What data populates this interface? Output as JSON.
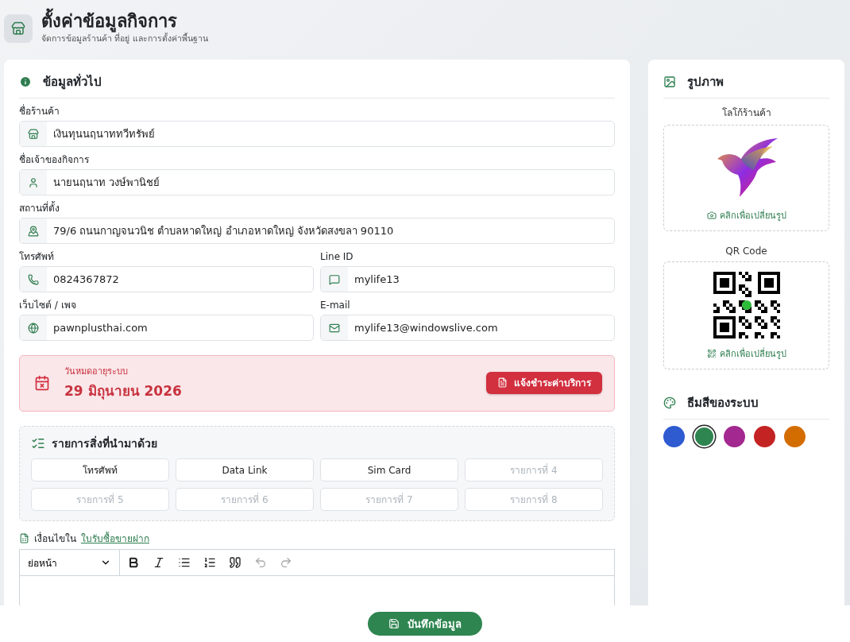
{
  "header": {
    "title": "ตั้งค่าข้อมูลกิจการ",
    "subtitle": "จัดการข้อมูลร้านค้า ที่อยู่ และการตั้งค่าพื้นฐาน"
  },
  "general": {
    "title": "ข้อมูลทั่วไป",
    "rows": [
      [
        {
          "label": "ชื่อร้านค้า",
          "value": "เงินทุนนฤนาททวีทรัพย์"
        }
      ],
      [
        {
          "label": "ชื่อเจ้าของกิจการ",
          "value": "นายนฤนาท วงษ์พานิชย์"
        }
      ],
      [
        {
          "label": "สถานที่ตั้ง",
          "value": "79/6 ถนนกาญจนวนิช ตำบลหาดใหญ่ อำเภอหาดใหญ่ จังหวัดสงขลา 90110"
        }
      ],
      [
        {
          "label": "โทรศัพท์",
          "value": "0824367872"
        },
        {
          "label": "Line ID",
          "value": "mylife13"
        }
      ],
      [
        {
          "label": "เว็บไซต์ / เพจ",
          "value": "pawnplusthai.com"
        },
        {
          "label": "E-mail",
          "value": "mylife13@windowslive.com"
        }
      ]
    ]
  },
  "expiry": {
    "label": "วันหมดอายุระบบ",
    "date": "29 มิถุนายน 2026",
    "button": "แจ้งชำระค่าบริการ"
  },
  "items": {
    "title": "รายการสิ่งที่นำมาด้วย",
    "entries": [
      {
        "value": "โทรศัพท์"
      },
      {
        "value": "Data Link"
      },
      {
        "value": "Sim Card"
      },
      {
        "placeholder": "รายการที่ 4"
      },
      {
        "placeholder": "รายการที่ 5"
      },
      {
        "placeholder": "รายการที่ 6"
      },
      {
        "placeholder": "รายการที่ 7"
      },
      {
        "placeholder": "รายการที่ 8"
      }
    ]
  },
  "terms": {
    "label": "เงื่อนไขใน",
    "link": "ใบรับซื้อขายฝาก"
  },
  "editor": {
    "block_style": "ย่อหน้า",
    "tools": [
      {
        "kind": "bold",
        "disabled": false
      },
      {
        "kind": "italic",
        "disabled": false
      },
      {
        "kind": "bullets",
        "disabled": false
      },
      {
        "kind": "numbers",
        "disabled": false
      },
      {
        "kind": "quote",
        "disabled": false
      },
      {
        "kind": "undo",
        "disabled": true
      },
      {
        "kind": "redo",
        "disabled": true
      }
    ]
  },
  "images": {
    "title": "รูปภาพ",
    "logo_label": "โลโก้ร้านค้า",
    "logo_action": "คลิกเพื่อเปลี่ยนรูป",
    "qr_label": "QR Code",
    "qr_action": "คลิกเพื่อเปลี่ยนรูป"
  },
  "theme": {
    "title": "ธีมสีของระบบ",
    "colors": [
      {
        "color": "#2f5bd1",
        "selected": false
      },
      {
        "color": "#2e8550",
        "selected": true
      },
      {
        "color": "#a3288f",
        "selected": false
      },
      {
        "color": "#c42323",
        "selected": false
      },
      {
        "color": "#d46d00",
        "selected": false
      }
    ]
  },
  "footer": {
    "save": "บันทึกข้อมูล"
  }
}
